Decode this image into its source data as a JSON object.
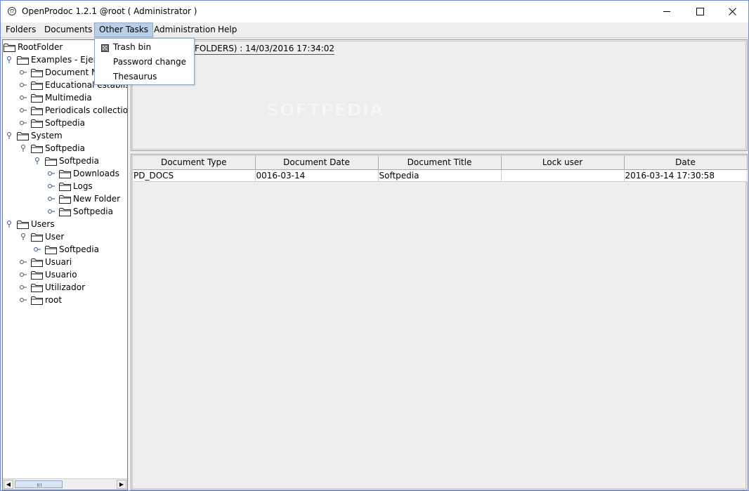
{
  "window": {
    "title": "OpenProdoc 1.2.1 @root ( Administrator )"
  },
  "menubar": {
    "items": [
      "Folders",
      "Documents",
      "Other Tasks",
      "Administration",
      "Help"
    ],
    "active": "Other Tasks"
  },
  "dropdown": {
    "items": [
      {
        "label": "Trash bin",
        "icon": "trash-icon"
      },
      {
        "label": "Password change"
      },
      {
        "label": "Thesaurus"
      }
    ]
  },
  "tree": {
    "nodes": [
      {
        "label": "RootFolder",
        "depth": 0,
        "handle": "none"
      },
      {
        "label": "Examples - Ejem",
        "depth": 1,
        "handle": "expanded"
      },
      {
        "label": "Document M",
        "depth": 2,
        "handle": "collapsed"
      },
      {
        "label": "Educational establisi",
        "depth": 2,
        "handle": "collapsed"
      },
      {
        "label": "Multimedia",
        "depth": 2,
        "handle": "collapsed"
      },
      {
        "label": "Periodicals collection",
        "depth": 2,
        "handle": "collapsed"
      },
      {
        "label": "Softpedia",
        "depth": 2,
        "handle": "collapsed"
      },
      {
        "label": "System",
        "depth": 1,
        "handle": "expanded"
      },
      {
        "label": "Softpedia",
        "depth": 2,
        "handle": "expanded"
      },
      {
        "label": "Softpedia",
        "depth": 3,
        "handle": "expanded"
      },
      {
        "label": "Downloads",
        "depth": 4,
        "handle": "collapsed"
      },
      {
        "label": "Logs",
        "depth": 4,
        "handle": "collapsed"
      },
      {
        "label": "New Folder",
        "depth": 4,
        "handle": "collapsed"
      },
      {
        "label": "Softpedia",
        "depth": 4,
        "handle": "collapsed"
      },
      {
        "label": "Users",
        "depth": 1,
        "handle": "expanded"
      },
      {
        "label": "User",
        "depth": 2,
        "handle": "expanded"
      },
      {
        "label": "Softpedia",
        "depth": 3,
        "handle": "collapsed"
      },
      {
        "label": "Usuari",
        "depth": 2,
        "handle": "collapsed"
      },
      {
        "label": "Usuario",
        "depth": 2,
        "handle": "collapsed"
      },
      {
        "label": "Utilizador",
        "depth": 2,
        "handle": "collapsed"
      },
      {
        "label": "root",
        "depth": 2,
        "handle": "collapsed"
      }
    ]
  },
  "info": {
    "header": "FOLDERS) : 14/03/2016 17:34:02",
    "watermark": "SOFTPEDIA"
  },
  "documents": {
    "columns": [
      "Document Type",
      "Document Date",
      "Document Title",
      "Lock user",
      "Date"
    ],
    "rows": [
      [
        "PD_DOCS",
        "0016-03-14",
        "Softpedia",
        "",
        "2016-03-14 17:30:58"
      ]
    ]
  },
  "colors": {
    "menu_active_bg": "#b8cfe5",
    "panel_bg": "#eeeeee",
    "window_border": "#6e8ad2"
  }
}
